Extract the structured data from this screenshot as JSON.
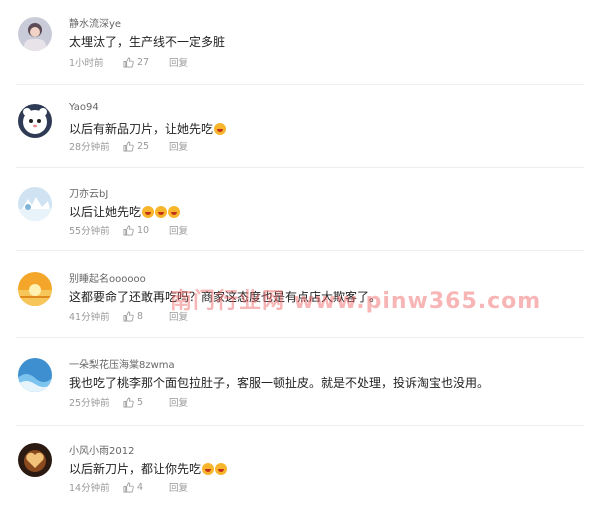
{
  "comments": [
    {
      "user": "静水流深ye",
      "text": "太埋汰了，生产线不一定多脏",
      "emoji_count": 0,
      "time": "1小时前",
      "likes": "27",
      "reply": "回复",
      "avatar": "person"
    },
    {
      "user": "Yao94",
      "text": "以后有新品刀片，让她先吃",
      "emoji_count": 1,
      "time": "28分钟前",
      "likes": "25",
      "reply": "回复",
      "avatar": "panda"
    },
    {
      "user": "刀亦云bJ",
      "text": "以后让她先吃",
      "emoji_count": 3,
      "time": "55分钟前",
      "likes": "10",
      "reply": "回复",
      "avatar": "snow"
    },
    {
      "user": "别睡起名oooooo",
      "text": "这都要命了还敢再吃吗？商家这态度也是有点店大欺客了。",
      "emoji_count": 0,
      "time": "41分钟前",
      "likes": "8",
      "reply": "回复",
      "avatar": "sunset"
    },
    {
      "user": "一朵梨花压海棠8zwma",
      "text": "我也吃了桃李那个面包拉肚子，客服一顿扯皮。就是不处理，投诉淘宝也没用。",
      "emoji_count": 0,
      "time": "25分钟前",
      "likes": "5",
      "reply": "回复",
      "avatar": "wave"
    },
    {
      "user": "小风小雨2012",
      "text": "以后新刀片，都让你先吃",
      "emoji_count": 2,
      "time": "14分钟前",
      "likes": "4",
      "reply": "回复",
      "avatar": "heart"
    }
  ],
  "watermark": "南门行业网 www.pinw365.com",
  "colors": {
    "text": "#222222",
    "meta": "#999999",
    "username": "#666666",
    "watermark": "#f05a5a"
  }
}
